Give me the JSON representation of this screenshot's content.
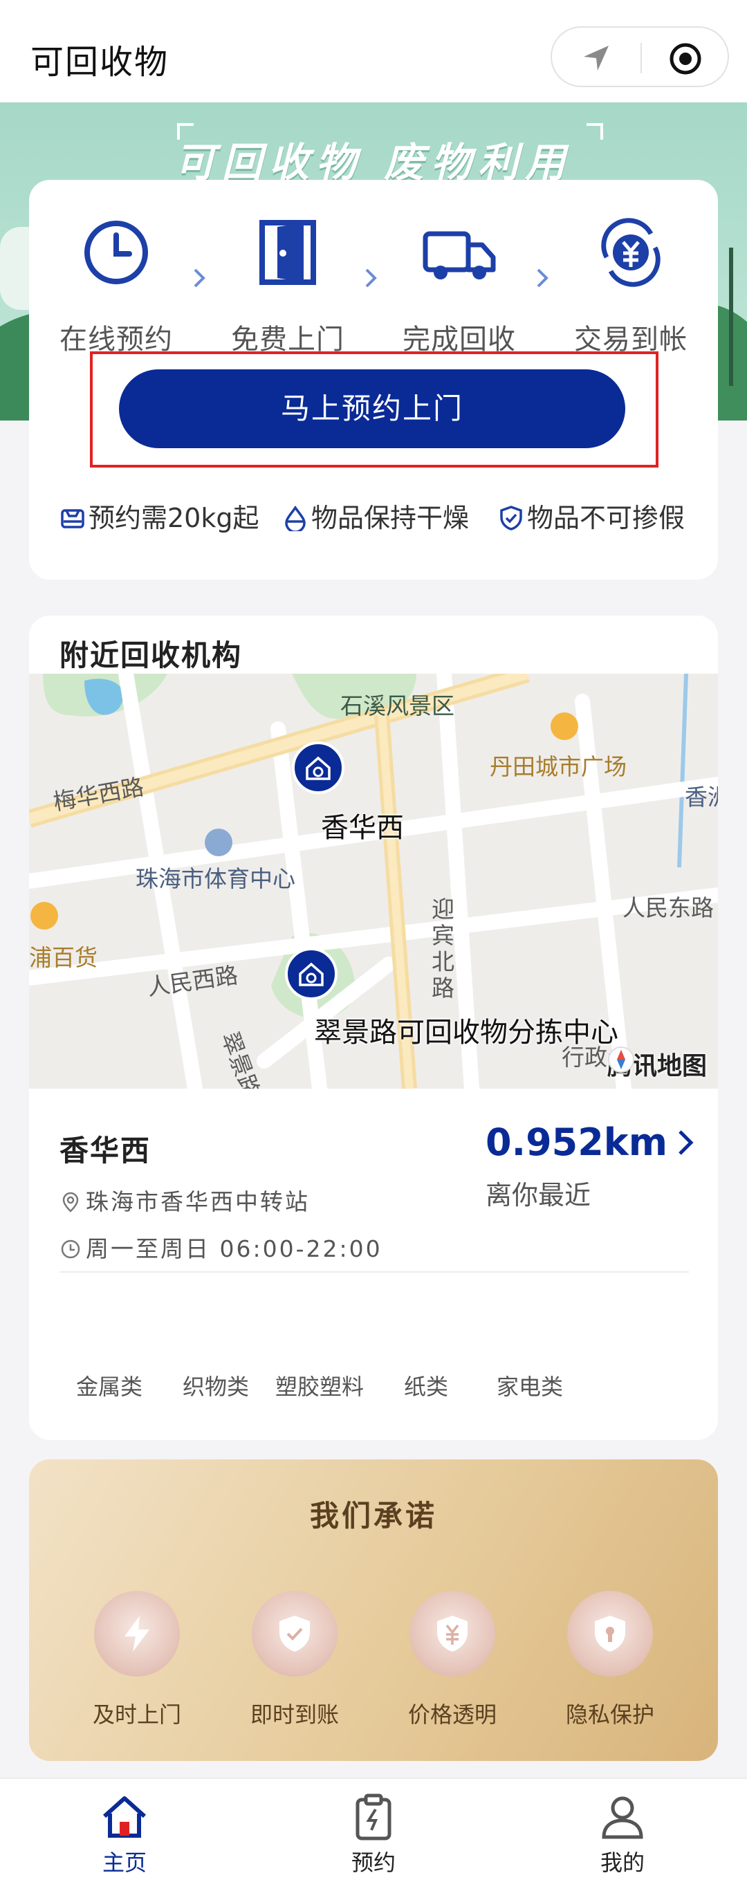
{
  "app": {
    "title": "可回收物"
  },
  "banner": {
    "slogan": "可回收物 废物利用"
  },
  "steps": [
    {
      "label": "在线预约",
      "icon": "clock-icon"
    },
    {
      "label": "免费上门",
      "icon": "door-icon"
    },
    {
      "label": "完成回收",
      "icon": "truck-icon"
    },
    {
      "label": "交易到帐",
      "icon": "yuan-refresh-icon"
    }
  ],
  "cta": {
    "label": "马上预约上门"
  },
  "tips": [
    {
      "label": "预约需20kg起",
      "icon": "scale-icon"
    },
    {
      "label": "物品保持干燥",
      "icon": "drop-icon"
    },
    {
      "label": "物品不可掺假",
      "icon": "shield-check-icon"
    }
  ],
  "nearby": {
    "heading": "附近回收机构",
    "map": {
      "labels": {
        "scenic": "石溪风景区",
        "danTian": "丹田城市广场",
        "meihua": "梅华西路",
        "xiangR": "香洲",
        "xianghuaxi": "香华西",
        "sports": "珠海市体育中心",
        "yingbin": "迎宾北路",
        "renminE": "人民东路",
        "baihuo": "浦百货",
        "renminW": "人民西路",
        "cuijing": "翠景路",
        "sorting": "翠景路可回收物分拣中心",
        "xingshang": "行政",
        "tencent": "腾讯地图"
      }
    },
    "station": {
      "name": "香华西",
      "address": "珠海市香华西中转站",
      "hours": "周一至周日 06:00-22:00",
      "distance": "0.952km",
      "distance_note": "离你最近"
    },
    "categories": [
      "金属类",
      "织物类",
      "塑胶塑料",
      "纸类",
      "家电类"
    ]
  },
  "promise": {
    "heading": "我们承诺",
    "items": [
      {
        "label": "及时上门",
        "icon": "lightning-icon"
      },
      {
        "label": "即时到账",
        "icon": "shield-check-icon"
      },
      {
        "label": "价格透明",
        "icon": "shield-yuan-icon"
      },
      {
        "label": "隐私保护",
        "icon": "shield-lock-icon"
      }
    ]
  },
  "tabbar": [
    {
      "label": "主页",
      "icon": "home-icon",
      "active": true
    },
    {
      "label": "预约",
      "icon": "clipboard-icon",
      "active": false
    },
    {
      "label": "我的",
      "icon": "user-icon",
      "active": false
    }
  ],
  "colors": {
    "primary": "#0a2b96",
    "highlight": "#e12222",
    "gold": "#d8b47b"
  }
}
